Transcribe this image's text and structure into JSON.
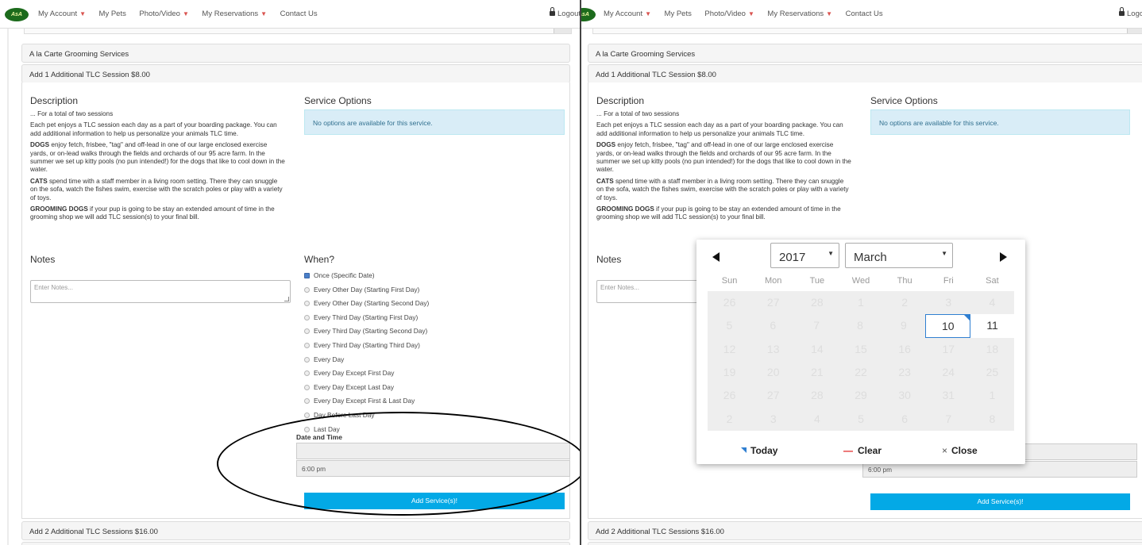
{
  "nav": {
    "logo_text": "AsA",
    "items": [
      "My Account",
      "My Pets",
      "Photo/Video",
      "My Reservations",
      "Contact Us"
    ],
    "logout": "Logout",
    "logout_cut": "Logo"
  },
  "section_title": "A la Carte Grooming Services",
  "service1_title": "Add 1 Additional TLC Session $8.00",
  "description": {
    "heading": "Description",
    "sub": "... For a total of two sessions",
    "intro": "Each pet enjoys a TLC session each day as a part of your boarding package. You can add additional information to help us personalize your animals TLC time.",
    "dogs_label": "DOGS",
    "dogs_text": " enjoy fetch, frisbee, \"tag\" and off-lead in one of our large enclosed exercise yards, or on-lead walks through the fields and orchards of our 95 acre farm. In the summer we set up kitty pools (no pun intended!) for the dogs that like to cool down in the water.",
    "cats_label": "CATS",
    "cats_text": " spend time with a staff member in a living room setting. There they can snuggle on the sofa, watch the fishes swim, exercise with the scratch poles or play with a variety of toys.",
    "grooming_label": "GROOMING DOGS",
    "grooming_text": " if your pup is going to be stay an extended amount of time in the grooming shop we will add TLC session(s) to your final bill.",
    "grooming_text_partial": " if your pup is going to be stay an extended amount of time in the grooming shop we will add TLC session(s) to your final bill."
  },
  "service_options": {
    "heading": "Service Options",
    "message": "No options are available for this service."
  },
  "notes": {
    "heading": "Notes",
    "placeholder": "Enter Notes..."
  },
  "when": {
    "heading": "When?",
    "options": [
      "Once (Specific Date)",
      "Every Other Day (Starting First Day)",
      "Every Other Day (Starting Second Day)",
      "Every Third Day (Starting First Day)",
      "Every Third Day (Starting Second Day)",
      "Every Third Day (Starting Third Day)",
      "Every Day",
      "Every Day Except First Day",
      "Every Day Except Last Day",
      "Every Day Except First & Last Day",
      "Day Before Last Day",
      "Last Day"
    ],
    "selected_index": 0
  },
  "date_time": {
    "label": "Date and Time",
    "date_value": "",
    "time_value": "6:00 pm"
  },
  "add_button": "Add Service(s)!",
  "service2_title": "Add 2 Additional TLC Sessions $16.00",
  "calendar": {
    "year": "2017",
    "month": "March",
    "weekdays": [
      "Sun",
      "Mon",
      "Tue",
      "Wed",
      "Thu",
      "Fri",
      "Sat"
    ],
    "weeks": [
      [
        "26",
        "27",
        "28",
        "1",
        "2",
        "3",
        "4"
      ],
      [
        "5",
        "6",
        "7",
        "8",
        "9",
        "10",
        "11"
      ],
      [
        "12",
        "13",
        "14",
        "15",
        "16",
        "17",
        "18"
      ],
      [
        "19",
        "20",
        "21",
        "22",
        "23",
        "24",
        "25"
      ],
      [
        "26",
        "27",
        "28",
        "29",
        "30",
        "31",
        "1"
      ],
      [
        "2",
        "3",
        "4",
        "5",
        "6",
        "7",
        "8"
      ]
    ],
    "selected_day": "10",
    "today_label": "Today",
    "clear_label": "Clear",
    "close_label": "Close",
    "accent_color": "#2f7fd1"
  }
}
